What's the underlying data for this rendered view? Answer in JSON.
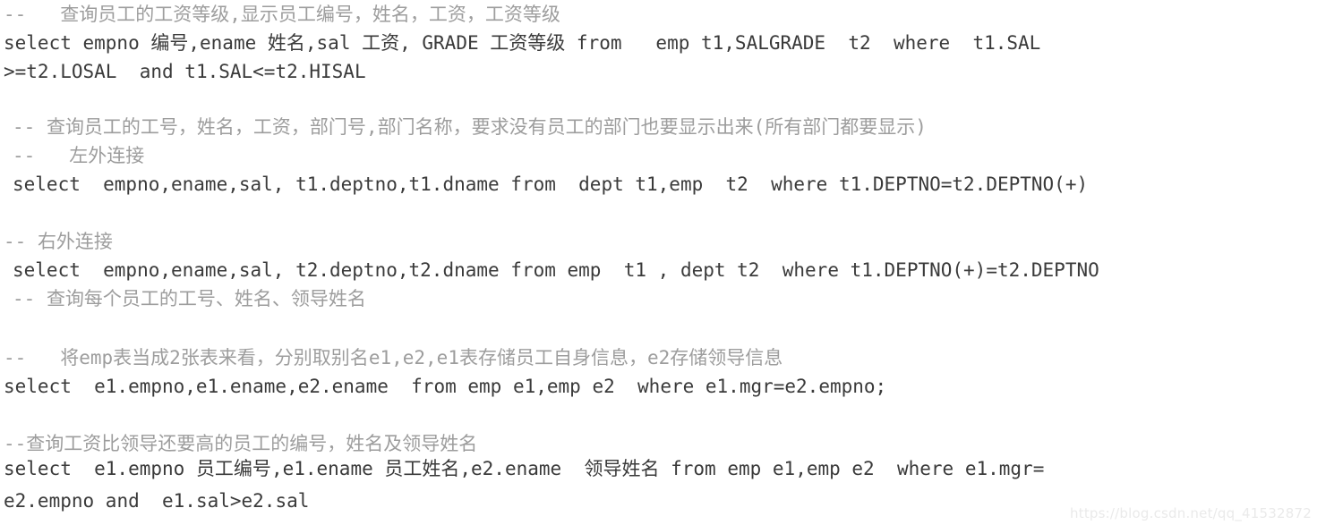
{
  "editor": {
    "background_color": "#ffffff",
    "keyword_color": "#0f76e8",
    "text_color": "#3a3a3a",
    "comment_color": "#9d9d9d",
    "language": "SQL"
  },
  "lines": [
    {
      "id": "line-1",
      "kind": "comment",
      "tokens": [
        {
          "type": "comment",
          "text": "--   查询员工的工资等级,显示员工编号，姓名，工资，工资等级"
        }
      ]
    },
    {
      "id": "line-2",
      "kind": "code",
      "tokens": [
        {
          "type": "keyword",
          "text": "select"
        },
        {
          "type": "plain",
          "text": " empno 编号,ename 姓名,sal 工资, GRADE 工资等级 "
        },
        {
          "type": "keyword",
          "text": "from"
        },
        {
          "type": "plain",
          "text": "   emp t1,SALGRADE  t2  "
        },
        {
          "type": "keyword",
          "text": "where"
        },
        {
          "type": "plain",
          "text": "  t1.SAL"
        }
      ]
    },
    {
      "id": "line-3",
      "kind": "code",
      "tokens": [
        {
          "type": "plain",
          "text": ">=t2.LOSAL  "
        },
        {
          "type": "keyword",
          "text": "and"
        },
        {
          "type": "plain",
          "text": " t1.SAL<=t2.HISAL"
        }
      ]
    },
    {
      "id": "line-4",
      "kind": "comment",
      "tokens": [
        {
          "type": "comment",
          "text": "-- 查询员工的工号，姓名，工资，部门号,部门名称，要求没有员工的部门也要显示出来(所有部门都要显示)"
        }
      ]
    },
    {
      "id": "line-5",
      "kind": "comment",
      "tokens": [
        {
          "type": "comment",
          "text": "--   左外连接"
        }
      ]
    },
    {
      "id": "line-6",
      "kind": "code",
      "tokens": [
        {
          "type": "keyword",
          "text": "select"
        },
        {
          "type": "plain",
          "text": "  empno,ename,sal, t1.deptno,t1.dname "
        },
        {
          "type": "keyword",
          "text": "from"
        },
        {
          "type": "plain",
          "text": "  dept t1,emp  t2  "
        },
        {
          "type": "keyword",
          "text": "where"
        },
        {
          "type": "plain",
          "text": " t1.DEPTNO=t2.DEPTNO(+)"
        }
      ]
    },
    {
      "id": "line-7",
      "kind": "comment",
      "tokens": [
        {
          "type": "comment",
          "text": "-- 右外连接"
        }
      ]
    },
    {
      "id": "line-8",
      "kind": "code",
      "tokens": [
        {
          "type": "keyword",
          "text": "select"
        },
        {
          "type": "plain",
          "text": "  empno,ename,sal, t2.deptno,t2.dname "
        },
        {
          "type": "keyword",
          "text": "from"
        },
        {
          "type": "plain",
          "text": " emp  t1 , dept t2  "
        },
        {
          "type": "keyword",
          "text": "where"
        },
        {
          "type": "plain",
          "text": " t1.DEPTNO(+)=t2.DEPTNO"
        }
      ]
    },
    {
      "id": "line-9",
      "kind": "comment",
      "tokens": [
        {
          "type": "comment",
          "text": "-- 查询每个员工的工号、姓名、领导姓名"
        }
      ]
    },
    {
      "id": "line-10",
      "kind": "comment",
      "tokens": [
        {
          "type": "comment",
          "text": "--   将emp表当成2张表来看，分别取别名e1,e2,e1表存储员工自身信息，e2存储领导信息"
        }
      ]
    },
    {
      "id": "line-11",
      "kind": "code",
      "tokens": [
        {
          "type": "keyword",
          "text": "select"
        },
        {
          "type": "plain",
          "text": "  e1.empno,e1.ename,e2.ename  "
        },
        {
          "type": "keyword",
          "text": "from"
        },
        {
          "type": "plain",
          "text": " emp e1,emp e2  "
        },
        {
          "type": "keyword",
          "text": "where"
        },
        {
          "type": "plain",
          "text": " e1.mgr=e2.empno;"
        }
      ]
    },
    {
      "id": "line-12",
      "kind": "comment",
      "tokens": [
        {
          "type": "comment",
          "text": "--查询工资比领导还要高的员工的编号，姓名及领导姓名"
        }
      ]
    },
    {
      "id": "line-13",
      "kind": "code",
      "tokens": [
        {
          "type": "keyword",
          "text": "select"
        },
        {
          "type": "plain",
          "text": "  e1.empno 员工编号,e1.ename 员工姓名,e2.ename  领导姓名 "
        },
        {
          "type": "keyword",
          "text": "from"
        },
        {
          "type": "plain",
          "text": " emp e1,emp e2  "
        },
        {
          "type": "keyword",
          "text": "where"
        },
        {
          "type": "plain",
          "text": " e1.mgr="
        }
      ]
    },
    {
      "id": "line-14",
      "kind": "code",
      "tokens": [
        {
          "type": "plain",
          "text": "e2.empno "
        },
        {
          "type": "keyword",
          "text": "and"
        },
        {
          "type": "plain",
          "text": "  e1.sal>e2.sal"
        }
      ]
    }
  ],
  "watermark": {
    "text": "https://blog.csdn.net/qq_41532872"
  }
}
